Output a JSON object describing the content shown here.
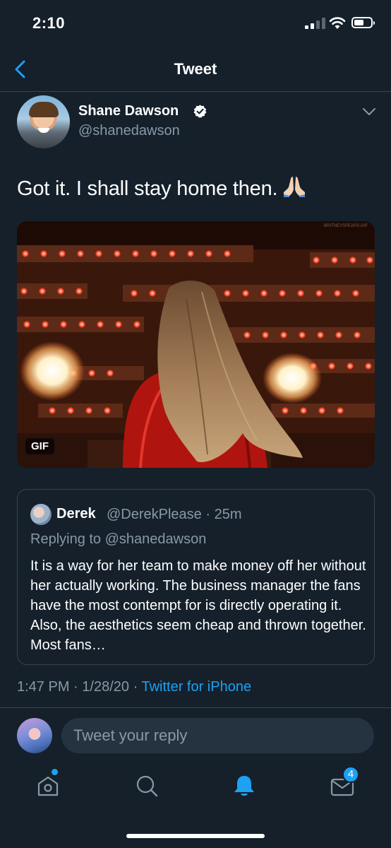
{
  "status_bar": {
    "time": "2:10",
    "signal_icon": "cellular-signal-icon",
    "wifi_icon": "wifi-icon",
    "battery_icon": "battery-icon",
    "battery_level": 0.6
  },
  "nav": {
    "back_icon": "chevron-left-icon",
    "title": "Tweet"
  },
  "tweet": {
    "author_name": "Shane Dawson",
    "verified_icon": "verified-badge-icon",
    "handle": "@shanedawson",
    "menu_icon": "chevron-down-icon",
    "text": "Got it. I shall stay home then.",
    "emoji": "folded-hands-emoji",
    "media": {
      "badge": "GIF",
      "watermark": "BRITNEYSPEARS.GIF"
    },
    "timestamp_time": "1:47 PM",
    "separator": "·",
    "timestamp_date": "1/28/20",
    "source": "Twitter for iPhone"
  },
  "quoted_tweet": {
    "author_name": "Derek",
    "meta": "@DerekPlease · 25m",
    "replying_to": "Replying to @shanedawson",
    "text": "It is a way for her team to make money off her without her actually working. The business manager the fans have the most contempt for is directly operating it. Also, the aesthetics seem cheap and thrown together. Most fans…"
  },
  "reply": {
    "placeholder": "Tweet your reply"
  },
  "tab_bar": {
    "tabs": [
      {
        "icon": "home-icon",
        "has_dot": true
      },
      {
        "icon": "search-icon"
      },
      {
        "icon": "notifications-bell-icon",
        "active": true
      },
      {
        "icon": "messages-envelope-icon",
        "badge": "4"
      }
    ]
  },
  "colors": {
    "background": "#15202b",
    "accent": "#1da1f2",
    "secondary_text": "#8899a6",
    "border": "#38444d"
  }
}
